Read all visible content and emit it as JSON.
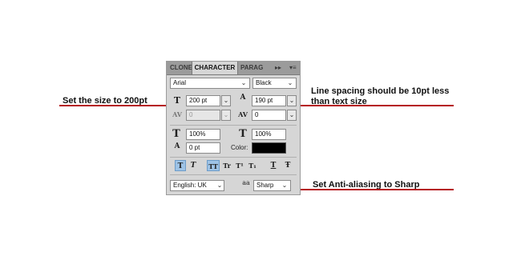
{
  "annotations": {
    "size": "Set the size to 200pt",
    "leading_line1": "Line spacing should be 10pt less",
    "leading_line2": "than text size",
    "antialias": "Set Anti-aliasing to Sharp"
  },
  "colors": {
    "annotation_line": "#b5151b",
    "text_color_swatch": "#000000"
  },
  "panel": {
    "tabs": [
      "CLONE",
      "CHARACTER",
      "PARAG"
    ],
    "menu_glyph": "▸▸",
    "options_glyph": "▾≡",
    "font_family": "Arial",
    "font_style": "Black",
    "font_size": "200 pt",
    "leading": "190 pt",
    "kerning": "0",
    "tracking": "0",
    "vertical_scale": "100%",
    "horizontal_scale": "100%",
    "baseline_shift": "0 pt",
    "color_label": "Color:",
    "language": "English: UK",
    "antialias_icon_text": "aa",
    "antialias": "Sharp",
    "style_buttons": [
      "T",
      "T",
      "TT",
      "Tr",
      "T¹",
      "T₁",
      "T",
      "Ŧ"
    ],
    "icons": {
      "font_size": "font-size-icon",
      "leading": "leading-icon",
      "kerning": "kerning-icon",
      "tracking": "tracking-icon",
      "vertical_scale": "vertical-scale-icon",
      "horizontal_scale": "horizontal-scale-icon",
      "baseline_shift": "baseline-shift-icon"
    }
  }
}
